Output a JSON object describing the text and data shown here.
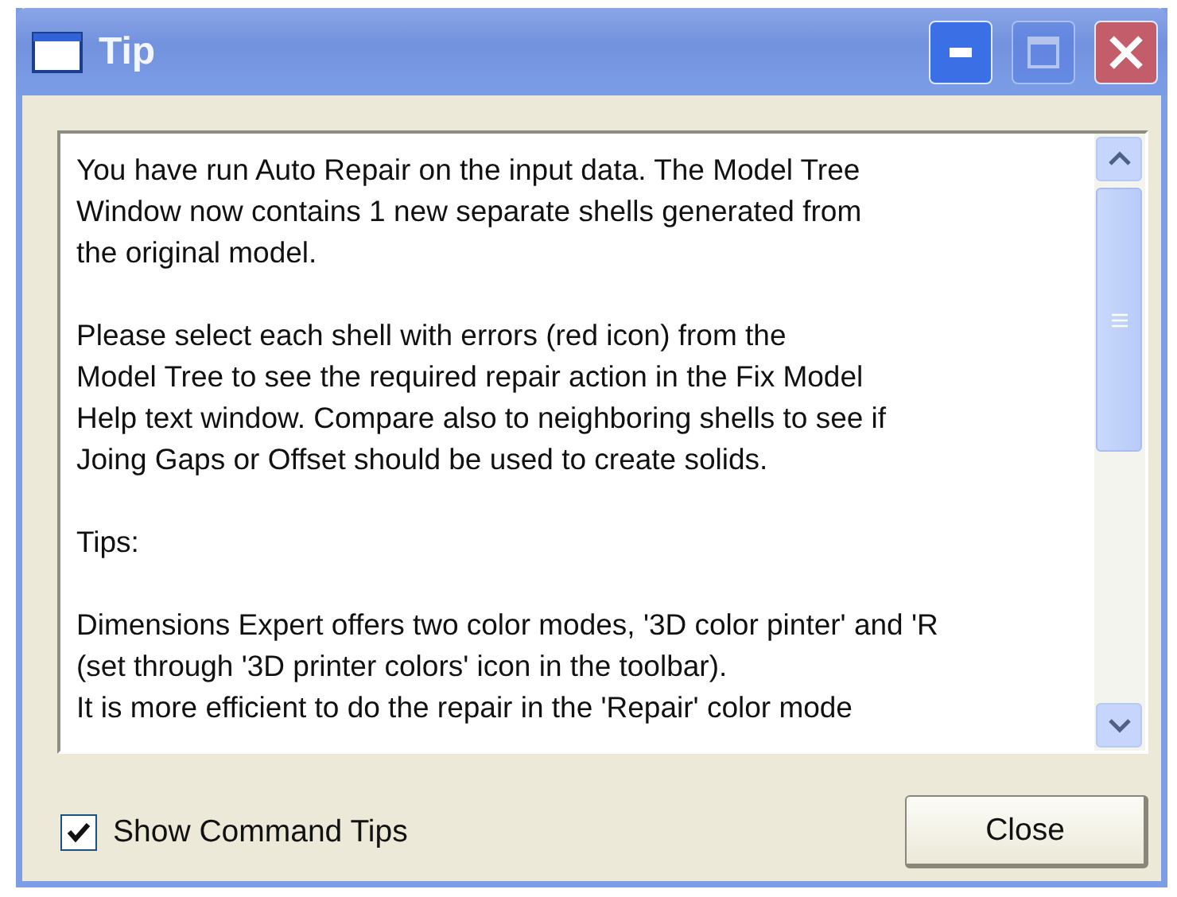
{
  "window": {
    "title": "Tip"
  },
  "title_buttons": [
    {
      "kind": "minimize",
      "disabled": false
    },
    {
      "kind": "maximize",
      "disabled": true
    },
    {
      "kind": "close",
      "disabled": false
    }
  ],
  "text_paragraphs": [
    [
      "You have run Auto Repair on the input data. The Model Tree",
      "Window now contains 1 new separate shells generated from",
      "the original model."
    ],
    [
      "Please select each shell with errors (red icon) from the",
      "Model Tree to see the required repair action in the Fix Model",
      "Help text window. Compare also to neighboring shells to see if",
      "Joing Gaps or Offset should be used to create solids."
    ],
    [
      "Tips:"
    ],
    [
      "Dimensions Expert offers two color modes, '3D color pinter' and 'R",
      "(set through '3D printer colors' icon in the toolbar).",
      "It is more efficient to do the repair in the 'Repair' color mode"
    ]
  ],
  "show_tips": {
    "label": "Show Command Tips",
    "checked": true
  },
  "buttons": [
    "Close"
  ]
}
